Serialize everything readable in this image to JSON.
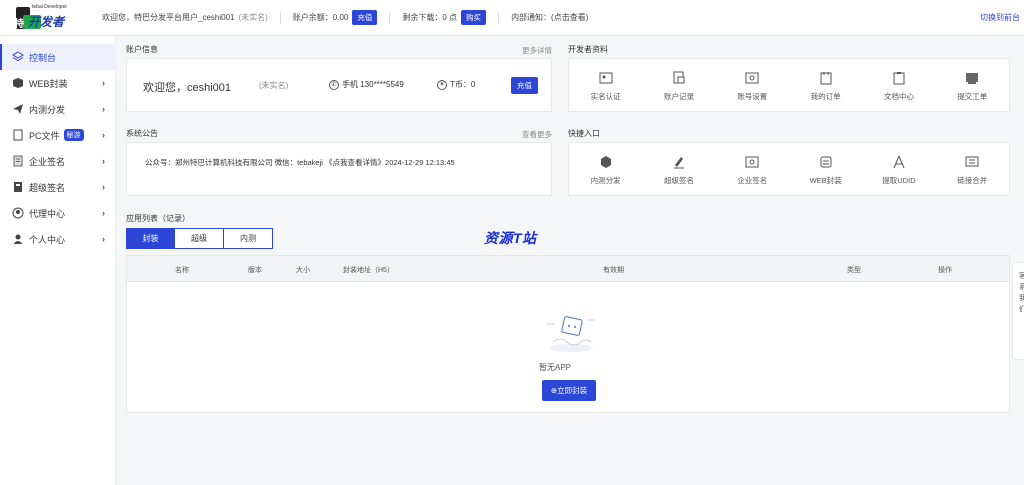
{
  "header": {
    "welcome": "欢迎您，特巴分发平台用户_ceshi001",
    "unreal": "(未实名)",
    "balance_label": "账户余额：0.00",
    "balance_btn": "充值",
    "downloads_label": "剩余下载：0 点",
    "downloads_btn": "购买",
    "internal_notice": "内部通知：(点击查看)",
    "switch_link": "切换到前台",
    "logo_text_a": "特",
    "logo_text_b": "开发者",
    "logo_tiny": "tebai Developer"
  },
  "sidebar": {
    "items": [
      {
        "label": "控制台",
        "icon": "layers-icon",
        "active": true
      },
      {
        "label": "WEB封装",
        "icon": "box-icon"
      },
      {
        "label": "内测分发",
        "icon": "send-icon"
      },
      {
        "label": "PC文件",
        "icon": "file-icon",
        "badge": "秘游"
      },
      {
        "label": "企业签名",
        "icon": "document-icon"
      },
      {
        "label": "超级签名",
        "icon": "signature-icon"
      },
      {
        "label": "代理中心",
        "icon": "agent-icon"
      },
      {
        "label": "个人中心",
        "icon": "user-icon"
      }
    ]
  },
  "account": {
    "title": "账户信息",
    "more": "更多详情",
    "welcome": "欢迎您，ceshi001",
    "unreal": "(未实名)",
    "phone": "手机 130****5549",
    "coins": "T币：0",
    "charge": "充值"
  },
  "developer": {
    "title": "开发者资料",
    "items": [
      {
        "label": "实名认证",
        "icon": "id-card-icon"
      },
      {
        "label": "账户记录",
        "icon": "record-icon"
      },
      {
        "label": "账号设置",
        "icon": "settings-icon"
      },
      {
        "label": "我的订单",
        "icon": "order-icon"
      },
      {
        "label": "文档中心",
        "icon": "docs-icon"
      },
      {
        "label": "提交工单",
        "icon": "ticket-icon"
      }
    ]
  },
  "notice": {
    "title": "系统公告",
    "more": "查看更多",
    "text": "公众号：郑州特巴计算机科技有限公司 微信：tebakeji 《点我查看详情》2024-12-29 12:13:45"
  },
  "quick": {
    "title": "快捷入口",
    "items": [
      {
        "label": "内测分发",
        "icon": "distribute-icon"
      },
      {
        "label": "超级签名",
        "icon": "pen-icon"
      },
      {
        "label": "企业签名",
        "icon": "enterprise-icon"
      },
      {
        "label": "WEB封装",
        "icon": "web-pack-icon"
      },
      {
        "label": "提取UDID",
        "icon": "udid-icon"
      },
      {
        "label": "链接合并",
        "icon": "merge-icon"
      }
    ]
  },
  "apps": {
    "title": "应用列表（记录）",
    "tabs": [
      "封装",
      "超级",
      "内测"
    ],
    "watermark": "资源T站",
    "columns": [
      "名称",
      "版本",
      "大小",
      "封装地址（H5）",
      "有效期",
      "类型",
      "操作"
    ],
    "empty_text": "暂无APP",
    "empty_button": "⊕立即封装"
  },
  "float": {
    "lines": [
      "客",
      "系",
      "我",
      "们"
    ]
  },
  "colors": {
    "accent": "#2c46d8"
  }
}
